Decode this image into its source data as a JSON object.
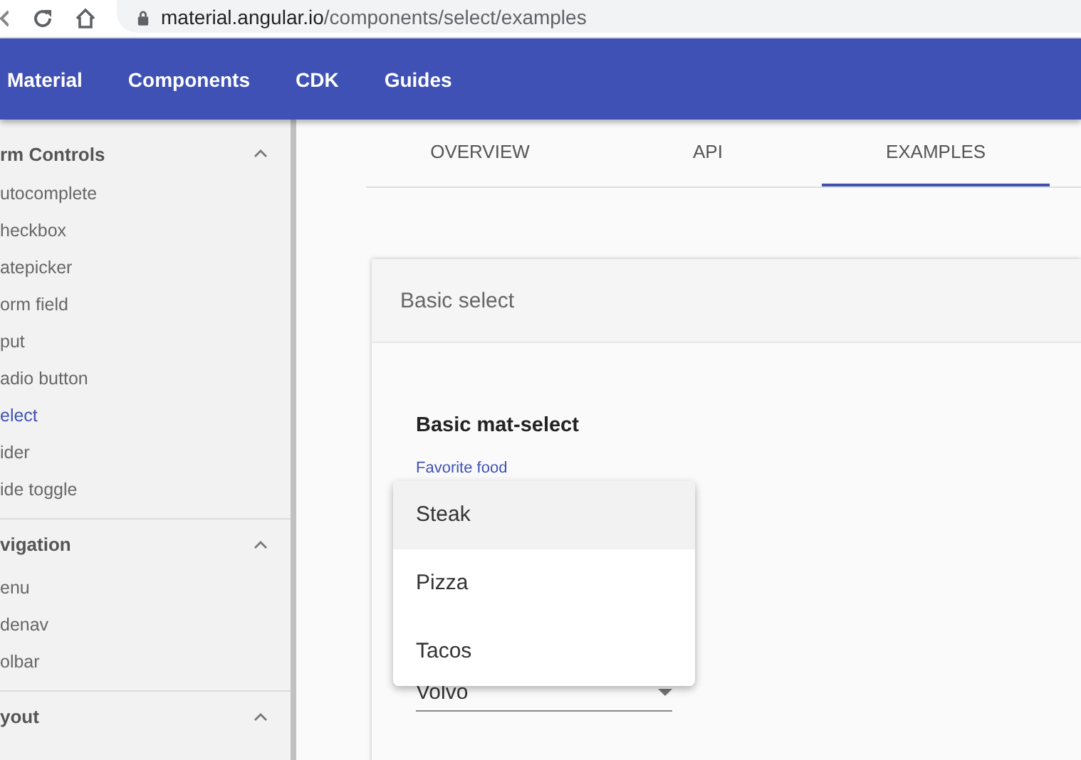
{
  "browser": {
    "url_host": "material.angular.io",
    "url_path": "/components/select/examples"
  },
  "header": {
    "nav": [
      {
        "label": "Material"
      },
      {
        "label": "Components"
      },
      {
        "label": "CDK"
      },
      {
        "label": "Guides"
      }
    ]
  },
  "sidebar": {
    "sections": [
      {
        "title": "rm Controls",
        "expanded": true,
        "items": [
          {
            "label": "utocomplete",
            "selected": false
          },
          {
            "label": "heckbox",
            "selected": false
          },
          {
            "label": "atepicker",
            "selected": false
          },
          {
            "label": "orm field",
            "selected": false
          },
          {
            "label": "put",
            "selected": false
          },
          {
            "label": "adio button",
            "selected": false
          },
          {
            "label": "elect",
            "selected": true
          },
          {
            "label": "ider",
            "selected": false
          },
          {
            "label": "ide toggle",
            "selected": false
          }
        ]
      },
      {
        "title": "vigation",
        "expanded": true,
        "items": [
          {
            "label": "enu",
            "selected": false
          },
          {
            "label": "denav",
            "selected": false
          },
          {
            "label": "olbar",
            "selected": false
          }
        ]
      },
      {
        "title": "yout",
        "expanded": true
      }
    ]
  },
  "tabs": [
    {
      "label": "OVERVIEW",
      "selected": false
    },
    {
      "label": "API",
      "selected": false
    },
    {
      "label": "EXAMPLES",
      "selected": true
    }
  ],
  "example": {
    "card_title": "Basic select",
    "heading": "Basic mat-select",
    "field_label": "Favorite food",
    "second_select_value": "Volvo",
    "dropdown": {
      "options": [
        {
          "label": "Steak",
          "selected": true
        },
        {
          "label": "Pizza",
          "selected": false
        },
        {
          "label": "Tacos",
          "selected": false
        }
      ]
    }
  }
}
